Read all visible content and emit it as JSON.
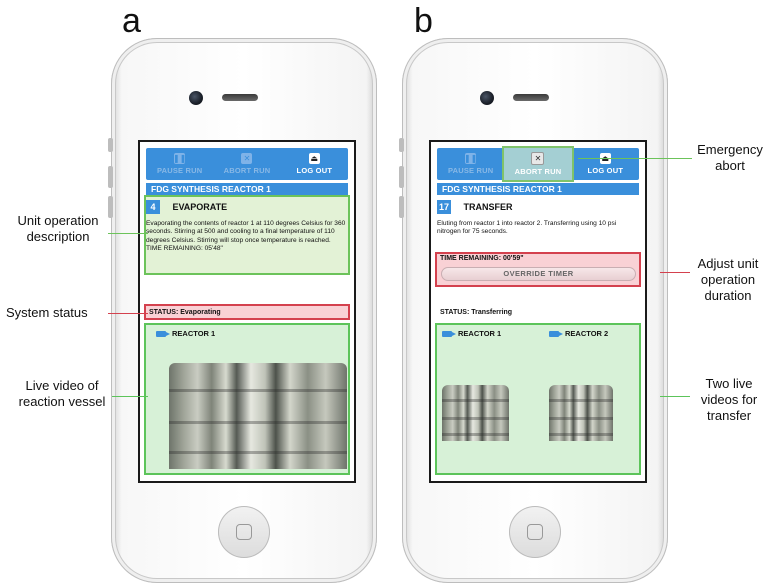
{
  "panels": {
    "a": {
      "letter": "a",
      "toolbar": {
        "pause": "PAUSE RUN",
        "abort": "ABORT RUN",
        "logout": "LOG OUT"
      },
      "reactor_title": "FDG SYNTHESIS REACTOR 1",
      "operation": {
        "number": "4",
        "name": "EVAPORATE",
        "description": "Evaporating the contents of reactor 1 at 110 degrees Celsius for 360 seconds.  Stirring at 500 and cooling to a final temperature of 110 degrees Celsius.  Stirring will stop once temperature is reached.",
        "time_remaining": "TIME REMAINING: 05'48\""
      },
      "status": "STATUS: Evaporating",
      "videos": [
        "REACTOR 1"
      ]
    },
    "b": {
      "letter": "b",
      "toolbar": {
        "pause": "PAUSE RUN",
        "abort": "ABORT RUN",
        "logout": "LOG OUT"
      },
      "reactor_title": "FDG SYNTHESIS REACTOR 1",
      "operation": {
        "number": "17",
        "name": "TRANSFER",
        "description": "Eluting from reactor 1 into reactor 2.  Transferring using 10 psi nitrogen for 75 seconds."
      },
      "time_remaining": "TIME REMAINING: 00'59\"",
      "override_button": "OVERRIDE TIMER",
      "status": "STATUS: Transferring",
      "videos": [
        "REACTOR 1",
        "REACTOR 2"
      ]
    }
  },
  "annotations": {
    "unit_op": "Unit operation description",
    "system_status": "System status",
    "live_video": "Live video of reaction vessel",
    "emergency_abort": "Emergency abort",
    "adjust_duration": "Adjust unit operation duration",
    "two_videos": "Two live videos for transfer"
  },
  "colors": {
    "accent_blue": "#3a8fdb",
    "highlight_green": "#6cc35a",
    "highlight_red": "#d4414e"
  },
  "icons": {
    "pause": "pause-icon",
    "abort": "close-icon",
    "logout": "eject-icon",
    "camera": "video-camera-icon"
  }
}
